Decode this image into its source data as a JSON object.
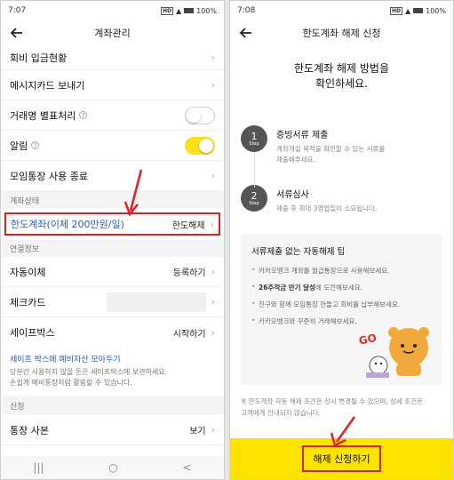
{
  "left": {
    "status": {
      "time": "7:07",
      "hd": "HD",
      "battery": "100%"
    },
    "title": "계좌관리",
    "rows_top": [
      {
        "label": "회비 입금현황"
      },
      {
        "label": "메시지카드 보내기"
      }
    ],
    "toggle_rows": [
      {
        "label": "거래명 별표처리",
        "state": "off"
      },
      {
        "label": "알림",
        "state": "on"
      }
    ],
    "end_row": {
      "label": "모임통장 사용 종료"
    },
    "section_account_status": "계좌상태",
    "limit_row": {
      "label": "한도계좌(이체 200만원/일)",
      "action": "한도해제"
    },
    "section_links": "연결정보",
    "link_rows": [
      {
        "label": "자동이체",
        "action": "등록하기"
      },
      {
        "label": "체크카드",
        "action": ""
      },
      {
        "label": "세이프박스",
        "action": "시작하기"
      }
    ],
    "safe_box": {
      "link": "세이프 박스에 예비자산 모아두기",
      "desc1": "당분간 사용하지 않을 돈은 세이프박스에 보관하세요.",
      "desc2": "손쉽게 예비통장처럼 활용할 수 있습니다."
    },
    "section_request": "신청",
    "copy_row": {
      "label": "통장 사본",
      "action": "보기"
    },
    "nav": {
      "recent": "|||",
      "home": "○",
      "back": "<"
    }
  },
  "right": {
    "status": {
      "time": "7:08",
      "hd": "HD",
      "battery": "100%"
    },
    "title": "한도계좌 해제 신청",
    "headline1": "한도계좌 해제 방법을",
    "headline2": "확인하세요.",
    "steps": [
      {
        "num": "1",
        "step": "Step",
        "title": "증빙서류 제출",
        "desc1": "계좌개설 목적을 확인할 수 있는 서류를",
        "desc2": "제출해주세요."
      },
      {
        "num": "2",
        "step": "Step",
        "title": "서류심사",
        "desc1": "제출 후 최대 3영업일이 소요됩니다.",
        "desc2": ""
      }
    ],
    "tips": {
      "heading": "서류제출 없는 자동해제 팁",
      "items": [
        {
          "bold": "",
          "text": "카카오뱅크 계좌를 월급통장으로 사용해보세요."
        },
        {
          "bold": "26주적금 만기 달성",
          "text": "에 도전해보세요."
        },
        {
          "bold": "",
          "text": "친구와 함께 모임통장 만들고 회비를 납부해보세요."
        },
        {
          "bold": "",
          "text": "카카오뱅크와 꾸준히 거래해보세요."
        }
      ],
      "sticker_text": "GO"
    },
    "notice1": "※ 한도계좌 자동 해제 조건은 상시 변경될 수 있으며, 상세 조건은",
    "notice2": "고객에게 안내되지 않습니다.",
    "cta": "해제 신청하기"
  },
  "colors": {
    "accent": "#ffe300",
    "highlight": "#e02020",
    "link": "#2c5cb5"
  }
}
